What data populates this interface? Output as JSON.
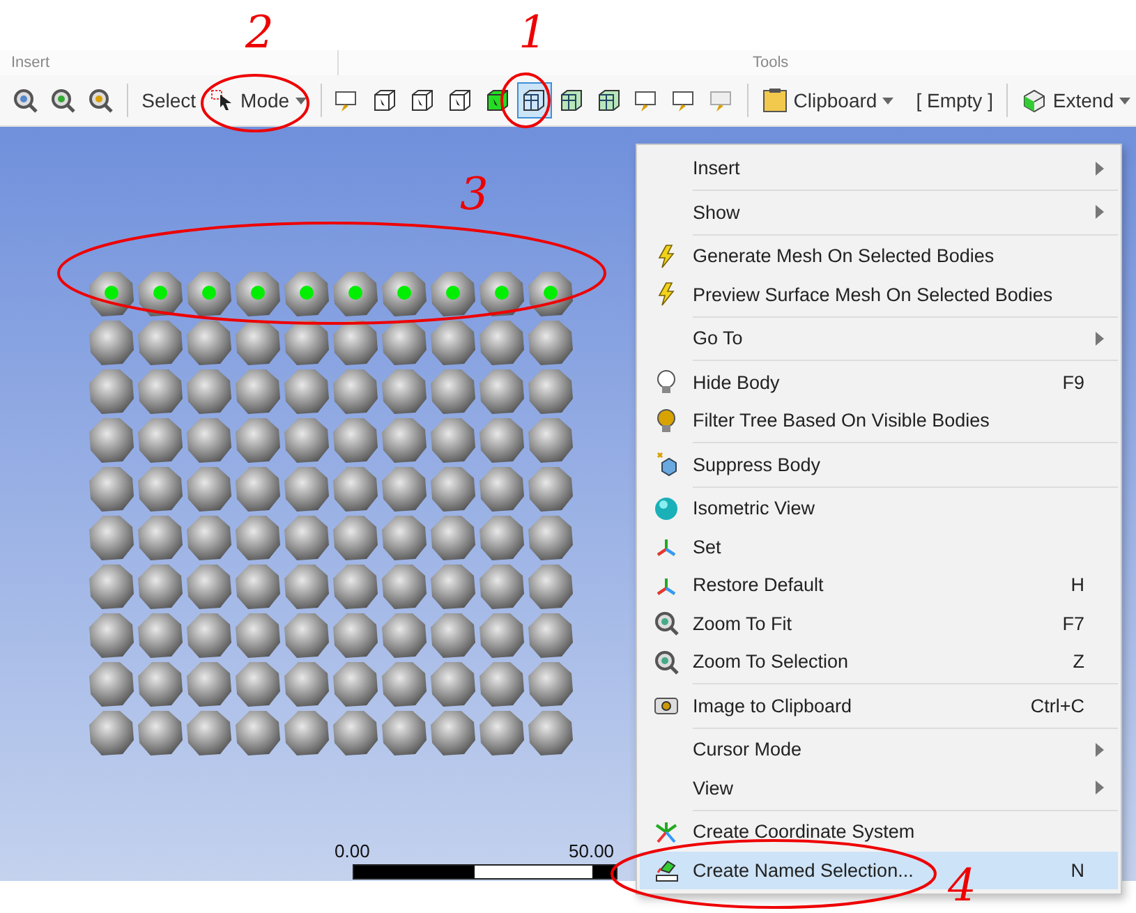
{
  "ribbon_groups": [
    "Insert",
    "Tools"
  ],
  "toolbar": {
    "select_label": "Select",
    "mode_button": "Mode",
    "filters": [
      {
        "selected": false
      },
      {
        "selected": false
      },
      {
        "selected": false
      },
      {
        "selected": false
      },
      {
        "selected": false
      },
      {
        "selected": true
      },
      {
        "selected": false
      },
      {
        "selected": false
      },
      {
        "selected": false
      },
      {
        "selected": false
      },
      {
        "selected": false
      }
    ],
    "clipboard_button": "Clipboard",
    "clipboard_value": "[ Empty ]",
    "extend_button": "Extend"
  },
  "viewport": {
    "body_rows": [
      {
        "selected": true
      },
      {
        "selected": false
      },
      {
        "selected": false
      },
      {
        "selected": false
      },
      {
        "selected": false
      },
      {
        "selected": false
      },
      {
        "selected": false
      },
      {
        "selected": false
      },
      {
        "selected": false
      },
      {
        "selected": false
      }
    ],
    "scale": {
      "start": "0.00",
      "end": "50.00"
    }
  },
  "context_menu": [
    {
      "kind": "submenu",
      "label": "Insert",
      "selected": false
    },
    {
      "kind": "separator"
    },
    {
      "kind": "submenu",
      "label": "Show",
      "selected": false
    },
    {
      "kind": "separator"
    },
    {
      "kind": "item",
      "label": "Generate Mesh On Selected Bodies",
      "selected": false
    },
    {
      "kind": "item",
      "label": "Preview Surface Mesh On Selected Bodies",
      "selected": false
    },
    {
      "kind": "separator"
    },
    {
      "kind": "submenu",
      "label": "Go To",
      "selected": false
    },
    {
      "kind": "separator"
    },
    {
      "kind": "item",
      "label": "Hide Body",
      "shortcut": "F9",
      "selected": false
    },
    {
      "kind": "item",
      "label": "Filter Tree Based On Visible Bodies",
      "selected": false
    },
    {
      "kind": "separator"
    },
    {
      "kind": "item",
      "label": "Suppress Body",
      "selected": false
    },
    {
      "kind": "separator"
    },
    {
      "kind": "item",
      "label": "Isometric View",
      "selected": false
    },
    {
      "kind": "item",
      "label": "Set",
      "selected": false
    },
    {
      "kind": "item",
      "label": "Restore Default",
      "shortcut": "H",
      "selected": false
    },
    {
      "kind": "item",
      "label": "Zoom To Fit",
      "shortcut": "F7",
      "selected": false
    },
    {
      "kind": "item",
      "label": "Zoom To Selection",
      "shortcut": "Z",
      "selected": false
    },
    {
      "kind": "separator"
    },
    {
      "kind": "item",
      "label": "Image to Clipboard",
      "shortcut": "Ctrl+C",
      "selected": false
    },
    {
      "kind": "separator"
    },
    {
      "kind": "submenu",
      "label": "Cursor Mode",
      "selected": false
    },
    {
      "kind": "submenu",
      "label": "View",
      "selected": false
    },
    {
      "kind": "separator"
    },
    {
      "kind": "item",
      "label": "Create Coordinate System",
      "selected": false
    },
    {
      "kind": "item",
      "label": "Create Named Selection...",
      "shortcut": "N",
      "selected": true
    }
  ],
  "annotations": [
    {
      "kind": "ellipse"
    },
    {
      "kind": "ellipse"
    },
    {
      "kind": "ellipse"
    },
    {
      "kind": "ellipse"
    },
    {
      "kind": "numeral",
      "text": "2"
    },
    {
      "kind": "numeral",
      "text": "1"
    },
    {
      "kind": "numeral",
      "text": "3"
    },
    {
      "kind": "numeral",
      "text": "4"
    }
  ]
}
